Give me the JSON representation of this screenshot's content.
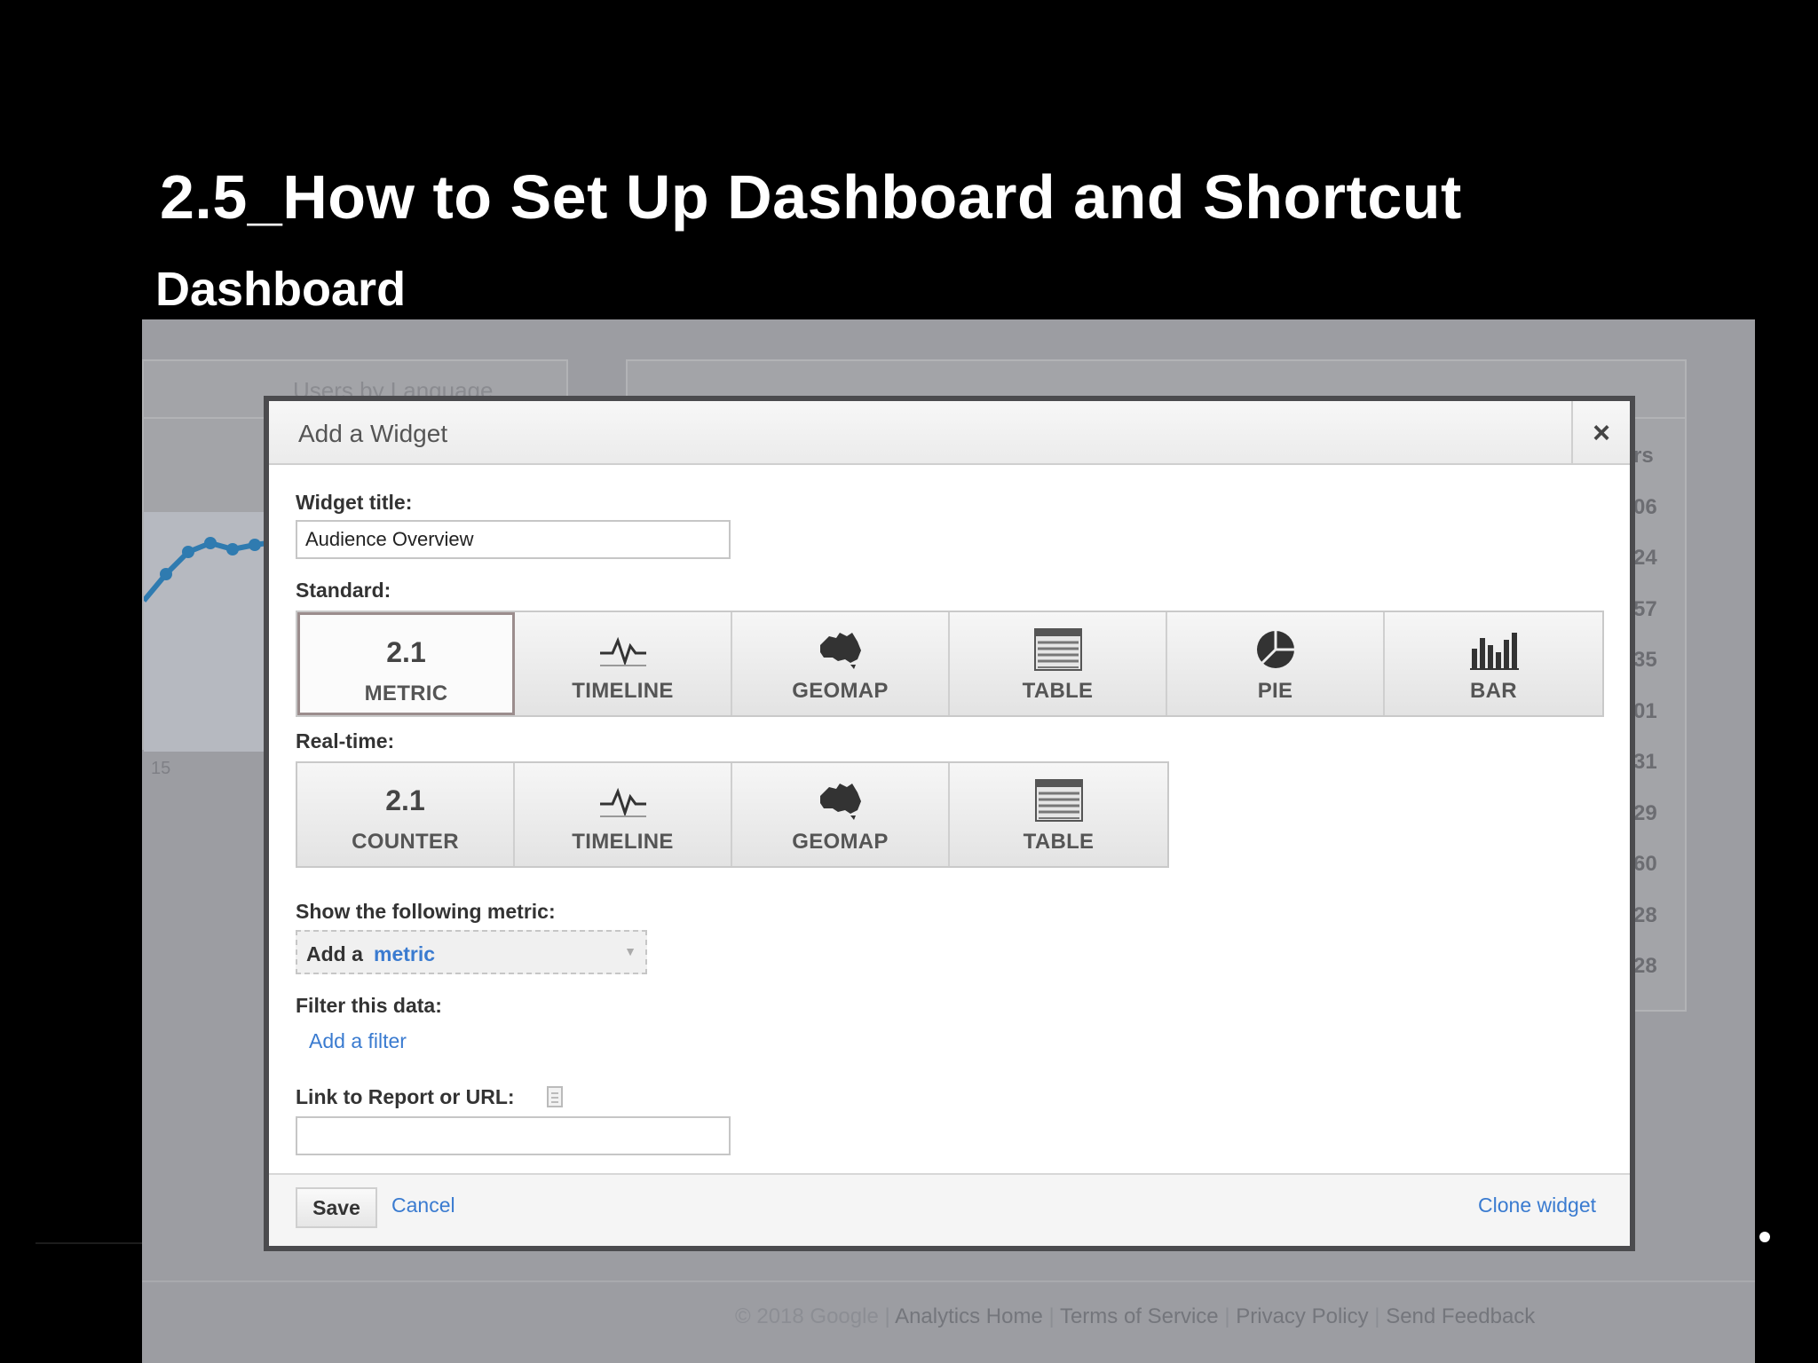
{
  "slide": {
    "title": "2.5_How to Set Up Dashboard and Shortcut",
    "subtitle": "Dashboard"
  },
  "background": {
    "panel_title": "Users by Language",
    "column_header": "rs",
    "column_values": [
      "06",
      "24",
      "57",
      "35",
      "01",
      "31",
      "29",
      "60",
      "28",
      "28"
    ],
    "chart_tick": "15",
    "footer": {
      "copyright": "© 2018 Google",
      "links": [
        "Analytics Home",
        "Terms of Service",
        "Privacy Policy",
        "Send Feedback"
      ],
      "separator": " | "
    }
  },
  "dialog": {
    "title": "Add a Widget",
    "close_icon": "close-icon",
    "widget_title_label": "Widget title:",
    "widget_title_value": "Audience Overview",
    "standard_label": "Standard:",
    "standard_tiles": [
      {
        "label": "METRIC",
        "icon": "metric-icon",
        "icon_text": "2.1",
        "selected": true
      },
      {
        "label": "TIMELINE",
        "icon": "timeline-icon"
      },
      {
        "label": "GEOMAP",
        "icon": "geomap-icon"
      },
      {
        "label": "TABLE",
        "icon": "table-icon"
      },
      {
        "label": "PIE",
        "icon": "pie-icon"
      },
      {
        "label": "BAR",
        "icon": "bar-icon"
      }
    ],
    "realtime_label": "Real-time:",
    "realtime_tiles": [
      {
        "label": "COUNTER",
        "icon": "counter-icon",
        "icon_text": "2.1"
      },
      {
        "label": "TIMELINE",
        "icon": "timeline-icon"
      },
      {
        "label": "GEOMAP",
        "icon": "geomap-icon"
      },
      {
        "label": "TABLE",
        "icon": "table-icon"
      }
    ],
    "metric_label": "Show the following metric:",
    "metric_prefix": "Add a",
    "metric_link": "metric",
    "filter_label": "Filter this data:",
    "filter_link": "Add a filter",
    "link_label": "Link to Report or URL:",
    "link_value": "",
    "save_label": "Save",
    "cancel_label": "Cancel",
    "clone_label": "Clone widget"
  }
}
